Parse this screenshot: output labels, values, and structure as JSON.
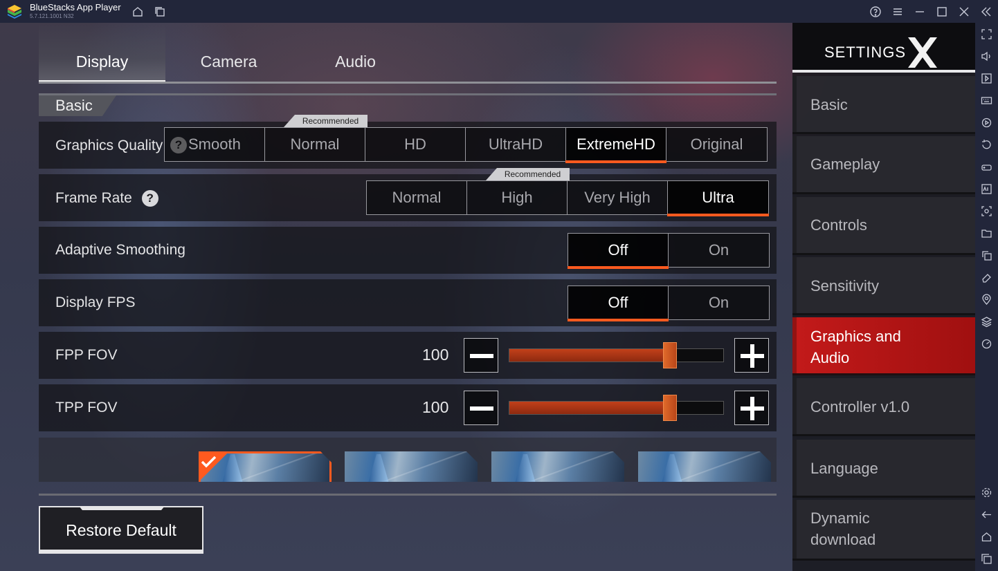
{
  "window": {
    "title": "BlueStacks App Player",
    "version": "5.7.121.1001  N32"
  },
  "tabs": [
    {
      "label": "Display",
      "active": true
    },
    {
      "label": "Camera",
      "active": false
    },
    {
      "label": "Audio",
      "active": false
    }
  ],
  "section": {
    "title": "Basic"
  },
  "graphics_quality": {
    "label": "Graphics Quality",
    "help_icon": "question-circle-icon",
    "recommended_label": "Recommended",
    "options": [
      "Smooth",
      "Normal",
      "HD",
      "UltraHD",
      "ExtremeHD",
      "Original"
    ],
    "selected": "ExtremeHD",
    "recommended": "Normal"
  },
  "frame_rate": {
    "label": "Frame Rate",
    "help_icon": "question-circle-icon",
    "recommended_label": "Recommended",
    "options": [
      "Normal",
      "High",
      "Very High",
      "Ultra"
    ],
    "selected": "Ultra",
    "recommended": "High"
  },
  "adaptive_smoothing": {
    "label": "Adaptive Smoothing",
    "options": [
      "Off",
      "On"
    ],
    "selected": "Off"
  },
  "display_fps": {
    "label": "Display FPS",
    "options": [
      "Off",
      "On"
    ],
    "selected": "Off"
  },
  "fpp_fov": {
    "label": "FPP FOV",
    "value": "100",
    "fill_fraction": 0.75
  },
  "tpp_fov": {
    "label": "TPP FOV",
    "value": "100",
    "fill_fraction": 0.75
  },
  "style_thumbnails": {
    "count": 4,
    "selected_index": 0
  },
  "restore_default": {
    "label": "Restore Default"
  },
  "settings_panel": {
    "title": "SETTINGS",
    "close_icon": "close-x-icon",
    "items": [
      {
        "label": "Basic",
        "active": false
      },
      {
        "label": "Gameplay",
        "active": false
      },
      {
        "label": "Controls",
        "active": false
      },
      {
        "label": "Sensitivity",
        "active": false
      },
      {
        "label": "Graphics and Audio",
        "active": true
      },
      {
        "label": "Controller v1.0",
        "active": false
      },
      {
        "label": "Language",
        "active": false
      },
      {
        "label": "Dynamic download",
        "active": false
      }
    ]
  },
  "colors": {
    "accent": "#ff5a1f",
    "active_menu": "#c31a1a",
    "titlebar": "#22263a"
  },
  "titlebar_icons": [
    "home-icon",
    "multi-instance-icon",
    "help-icon",
    "menu-icon",
    "minimize-icon",
    "maximize-icon",
    "close-icon",
    "collapse-sidebar-icon"
  ],
  "sidebar_icons": [
    "fullscreen-icon",
    "volume-icon",
    "media-icon",
    "keyboard-icon",
    "replay-icon",
    "rotate-icon",
    "gamepad-icon",
    "apk-icon",
    "screenshot-icon",
    "folder-icon",
    "copy-icon",
    "eraser-icon",
    "location-icon",
    "layers-icon",
    "performance-icon",
    "settings-icon",
    "back-icon",
    "home-nav-icon",
    "recent-apps-icon"
  ]
}
